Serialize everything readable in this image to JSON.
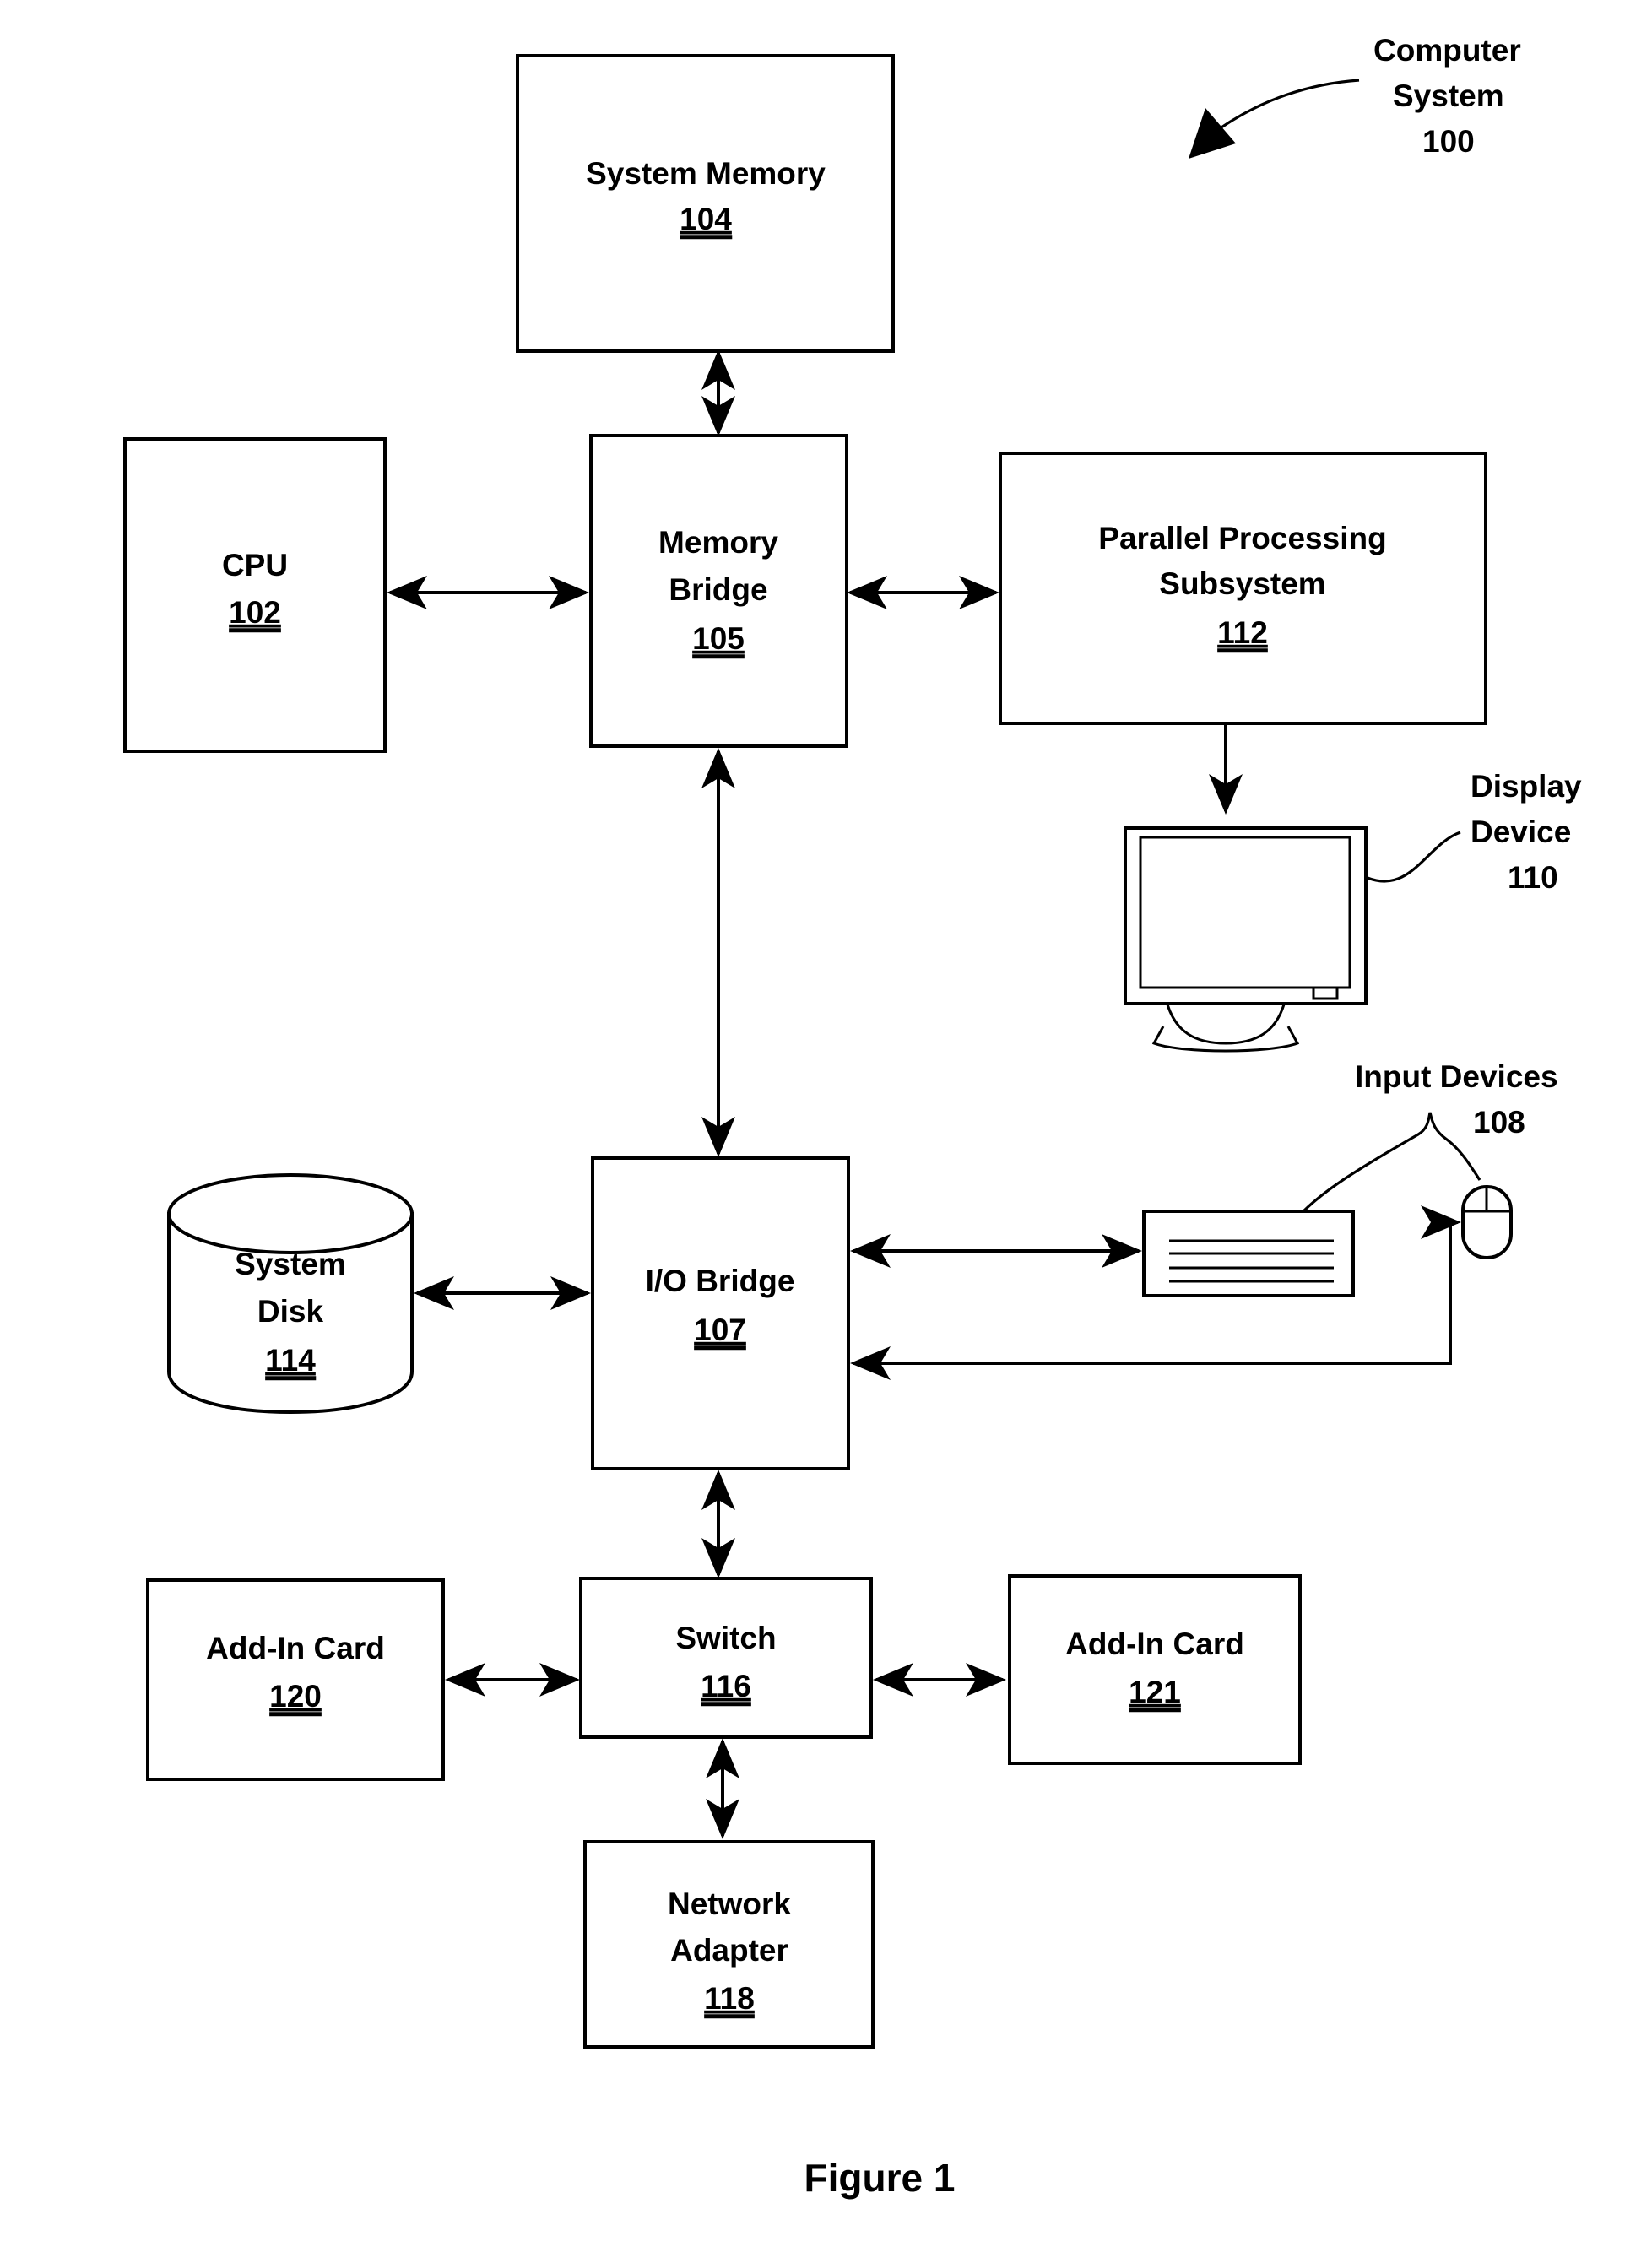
{
  "figure": {
    "caption": "Figure 1",
    "title_callout": {
      "line1": "Computer",
      "line2": "System",
      "ref": "100"
    }
  },
  "blocks": [
    {
      "id": "system-memory",
      "label_line1": "System Memory",
      "label_line2": "",
      "ref": "104"
    },
    {
      "id": "cpu",
      "label_line1": "CPU",
      "label_line2": "",
      "ref": "102"
    },
    {
      "id": "memory-bridge",
      "label_line1": "Memory",
      "label_line2": "Bridge",
      "ref": "105"
    },
    {
      "id": "parallel-processing-subsystem",
      "label_line1": "Parallel Processing",
      "label_line2": "Subsystem",
      "ref": "112"
    },
    {
      "id": "system-disk",
      "label_line1": "System",
      "label_line2": "Disk",
      "ref": "114"
    },
    {
      "id": "io-bridge",
      "label_line1": "I/O Bridge",
      "label_line2": "",
      "ref": "107"
    },
    {
      "id": "add-in-card-120",
      "label_line1": "Add-In Card",
      "label_line2": "",
      "ref": "120"
    },
    {
      "id": "switch",
      "label_line1": "Switch",
      "label_line2": "",
      "ref": "116"
    },
    {
      "id": "add-in-card-121",
      "label_line1": "Add-In Card",
      "label_line2": "",
      "ref": "121"
    },
    {
      "id": "network-adapter",
      "label_line1": "Network",
      "label_line2": "Adapter",
      "ref": "118"
    }
  ],
  "callouts": [
    {
      "id": "display-device",
      "line1": "Display",
      "line2": "Device",
      "ref": "110"
    },
    {
      "id": "input-devices",
      "line1": "Input Devices",
      "line2": "",
      "ref": "108"
    }
  ],
  "devices": [
    {
      "id": "display-monitor",
      "icon": "monitor-icon"
    },
    {
      "id": "keyboard",
      "icon": "keyboard-icon"
    },
    {
      "id": "mouse",
      "icon": "mouse-icon"
    }
  ],
  "colors": {
    "ink": "#000000",
    "paper": "#ffffff"
  }
}
